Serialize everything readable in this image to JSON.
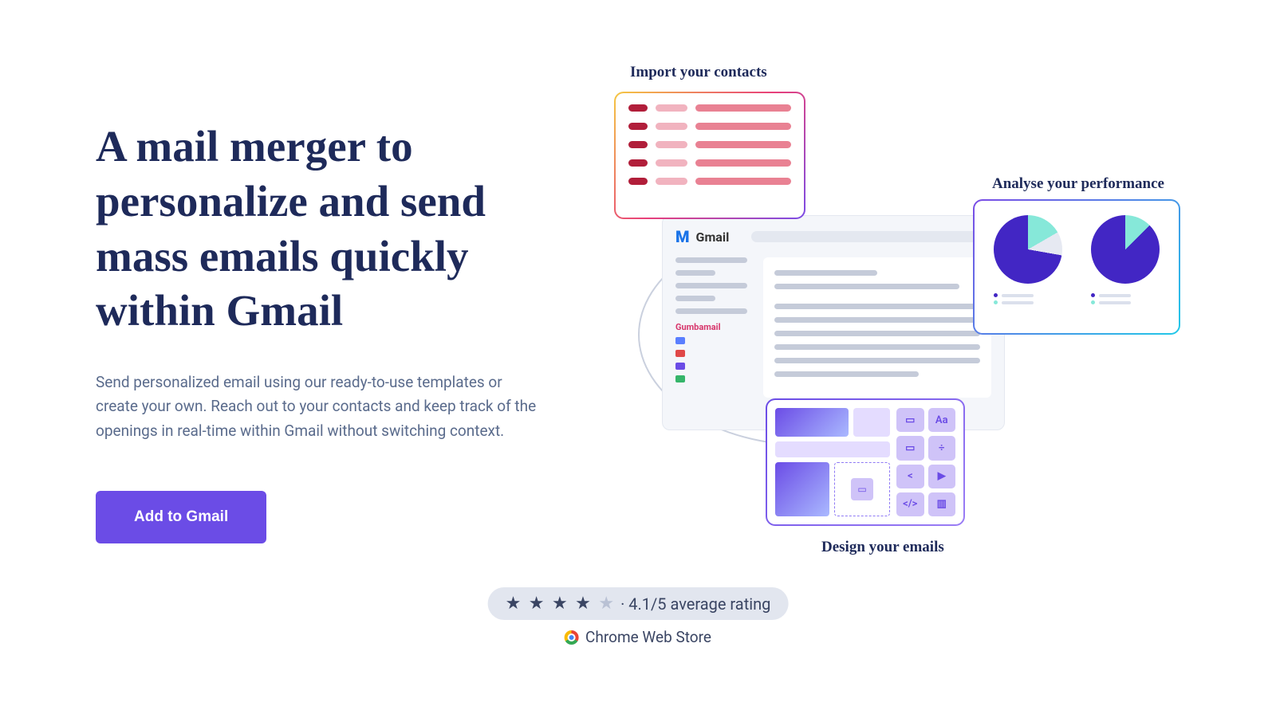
{
  "hero": {
    "title": "A mail merger to personalize and send mass emails quickly within Gmail",
    "subtitle": "Send personalized email using our ready-to-use templates or create your own. Reach out to your contacts and keep track of the openings in real-time within Gmail without switching context.",
    "cta_label": "Add to Gmail"
  },
  "illustration": {
    "import_label": "Import your contacts",
    "analyse_label": "Analyse your performance",
    "design_label": "Design your emails",
    "gmail_label": "Gmail",
    "gumbamail_label": "Gumbamail"
  },
  "rating": {
    "text": "· 4.1/5 average rating",
    "store_label": "Chrome Web Store",
    "stars_full": 4,
    "stars_total": 5,
    "value": 4.1
  },
  "colors": {
    "primary_button": "#6b4ce6",
    "heading": "#1e2a5a",
    "body_text": "#5a6b8c"
  }
}
